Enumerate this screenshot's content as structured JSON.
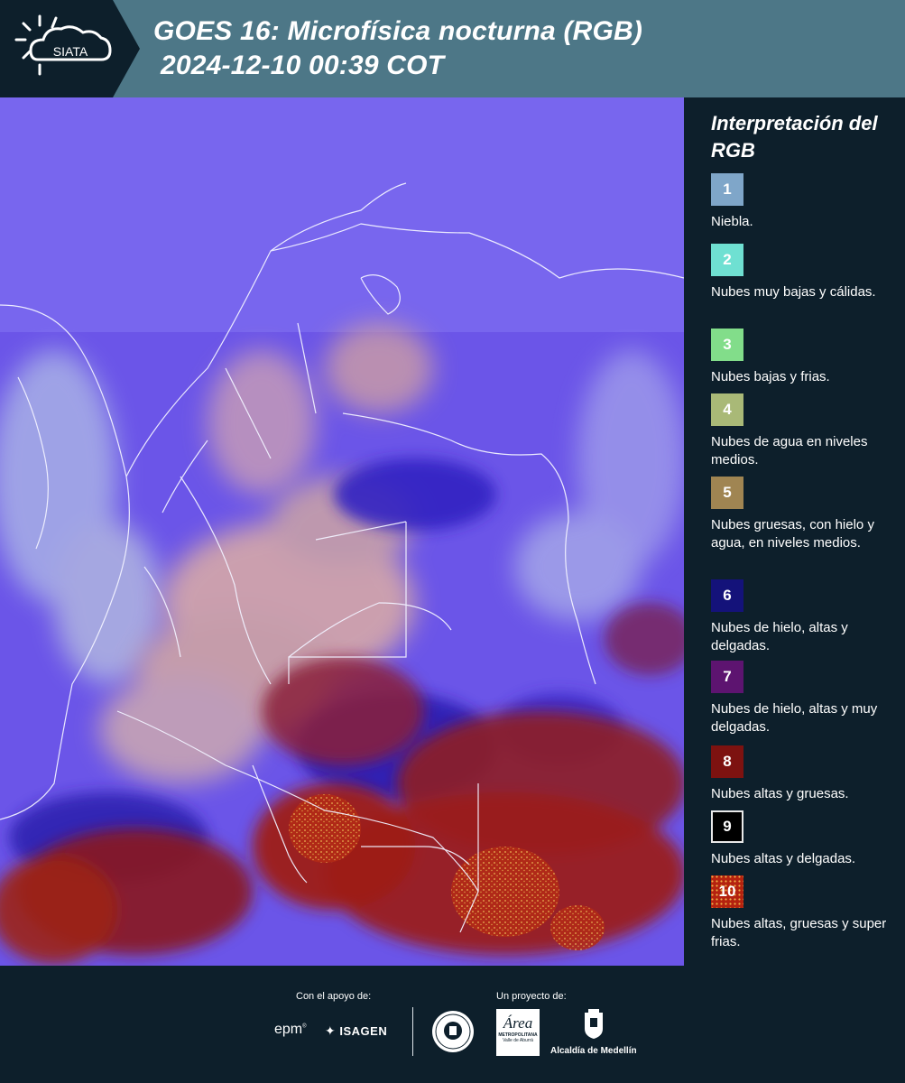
{
  "header": {
    "logo_text": "SIATA",
    "title_line1": "GOES 16: Microfísica nocturna (RGB)",
    "title_line2": "2024-12-10 00:39 COT"
  },
  "legend": {
    "title": "Interpretación del RGB",
    "items": [
      {
        "number": "1",
        "label": "Niebla.",
        "color": "#7fa6c9"
      },
      {
        "number": "2",
        "label": "Nubes muy bajas y cálidas.",
        "color": "#6fe0d2"
      },
      {
        "number": "3",
        "label": "Nubes bajas y frias.",
        "color": "#82dd8a"
      },
      {
        "number": "4",
        "label": "Nubes de agua en niveles medios.",
        "color": "#a9b977"
      },
      {
        "number": "5",
        "label": "Nubes gruesas, con hielo y agua, en niveles medios.",
        "color": "#a08552"
      },
      {
        "number": "6",
        "label": "Nubes de hielo, altas y delgadas.",
        "color": "#14127a"
      },
      {
        "number": "7",
        "label": "Nubes de hielo, altas y muy delgadas.",
        "color": "#5d1470"
      },
      {
        "number": "8",
        "label": "Nubes altas y gruesas.",
        "color": "#7d1210"
      },
      {
        "number": "9",
        "label": "Nubes altas y delgadas.",
        "color": "#000000"
      },
      {
        "number": "10",
        "label": "Nubes altas, gruesas y super frias.",
        "color": "#b4220f"
      }
    ]
  },
  "footer": {
    "support_label": "Con el apoyo de:",
    "project_label": "Un proyecto de:",
    "epm": "epm",
    "isagen": "ISAGEN",
    "area_name": "Área",
    "area_sub": "METROPOLITANA",
    "area_sub2": "Valle de Aburrá",
    "alcaldia": "Alcaldía de Medellín"
  }
}
